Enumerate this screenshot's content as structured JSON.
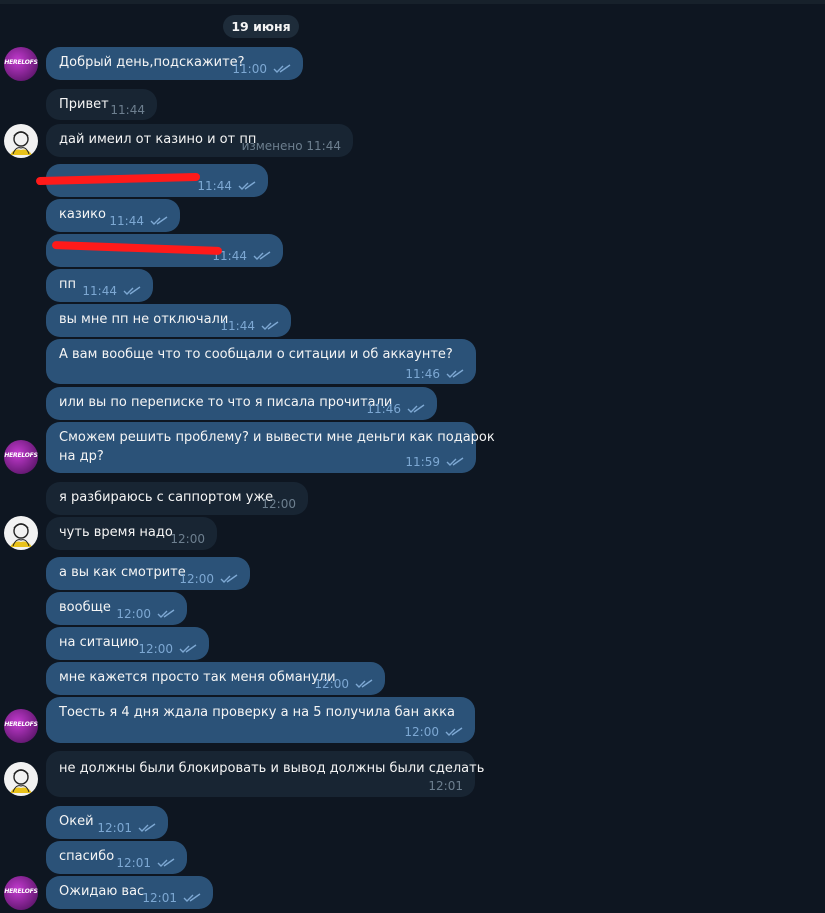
{
  "chat": {
    "date": "19 июня",
    "avatar_text": "HERELOFS",
    "messages": [
      {
        "text": "Добрый день,подскажите?",
        "time": "11:00"
      },
      {
        "text": "Привет",
        "time": "11:44"
      },
      {
        "text": "дай имеил от казино и от пп",
        "time": "изменено 11:44"
      },
      {
        "text": "",
        "time": "11:44"
      },
      {
        "text": "казико",
        "time": "11:44"
      },
      {
        "text": "",
        "time": "11:44"
      },
      {
        "text": "пп",
        "time": "11:44"
      },
      {
        "text": "вы мне пп не отключали",
        "time": "11:44"
      },
      {
        "text": "А вам вообще что то сообщали о ситации и об аккаунте?",
        "time": "11:46"
      },
      {
        "text": "или вы по переписке то что я писала прочитали",
        "time": "11:46"
      },
      {
        "text": "Сможем решить проблему? и вывести мне деньги как подарок",
        "text2": "на др?",
        "time": "11:59"
      },
      {
        "text": "я разбираюсь с саппортом уже",
        "time": "12:00"
      },
      {
        "text": "чуть время надо",
        "time": "12:00"
      },
      {
        "text": "а вы как смотрите",
        "time": "12:00"
      },
      {
        "text": "вообще",
        "time": "12:00"
      },
      {
        "text": "на ситацию",
        "time": "12:00"
      },
      {
        "text": "мне кажется просто так меня обманули",
        "time": "12:00"
      },
      {
        "text": "Тоесть я 4 дня ждала проверку а на 5 получила бан акка",
        "time": "12:00"
      },
      {
        "text": "не должны были блокировать и вывод должны были сделать",
        "time": "12:01"
      },
      {
        "text": "Окей",
        "time": "12:01"
      },
      {
        "text": "спасибо",
        "time": "12:01"
      },
      {
        "text": "Ожидаю вас",
        "time": "12:01"
      }
    ]
  },
  "colors": {
    "background": "#0e1621",
    "outgoing_bubble": "#2b5278",
    "incoming_bubble": "#182533",
    "read_check": "#7da8d3",
    "redaction": "#ff1a1a"
  }
}
